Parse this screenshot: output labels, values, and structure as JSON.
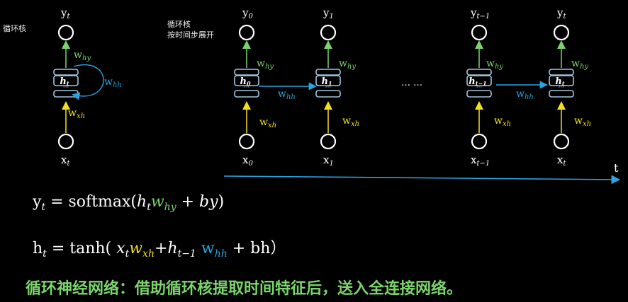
{
  "left_title": "循环核",
  "right_title": [
    "循环核",
    "按时间步展开"
  ],
  "cell_left": {
    "y": "y",
    "y_sub": "t",
    "x": "x",
    "x_sub": "t",
    "h": "h",
    "h_sub": "t"
  },
  "cells": [
    {
      "y": "y",
      "y_sub": "0",
      "x": "x",
      "x_sub": "0",
      "h": "h",
      "h_sub": "0"
    },
    {
      "y": "y",
      "y_sub": "1",
      "x": "x",
      "x_sub": "1",
      "h": "h",
      "h_sub": "1"
    },
    {
      "y": "y",
      "y_sub": "t−1",
      "x": "x",
      "x_sub": "t−1",
      "h": "h",
      "h_sub": "t−1"
    },
    {
      "y": "y",
      "y_sub": "t",
      "x": "x",
      "x_sub": "t",
      "h": "h",
      "h_sub": "t"
    }
  ],
  "weights": {
    "w": "w",
    "hy": "hy",
    "hh": "hh",
    "xh": "xh"
  },
  "ellipsis": "… …",
  "time_axis": "t",
  "eq1": {
    "lhs": "y",
    "lhs_sub": "t",
    "equals": "=",
    "func": "softmax(",
    "h": "h",
    "h_sub": "t",
    "w": "w",
    "w_sub": "hy",
    "plus": "+",
    "by": "by",
    "close": ")"
  },
  "eq2": {
    "lhs": "h",
    "lhs_sub": "t",
    "equals": "=",
    "func": "tanh(",
    "x": "x",
    "x_sub": "t",
    "w1": "w",
    "w1_sub": "xh",
    "plus1": "+",
    "h": "h",
    "h_sub": "t−1",
    "w2": "w",
    "w2_sub": "hh",
    "plus2": "+",
    "bh": "bh",
    "close": "）"
  },
  "caption": "循环神经网络：借助循环核提取时间特征后，送入全连接网络。",
  "colors": {
    "green": "#7bd46b",
    "yellow": "#f2e020",
    "blue": "#2aa4e0",
    "cell_border": "#9fc6dd",
    "axis": "#2aa4e0"
  }
}
